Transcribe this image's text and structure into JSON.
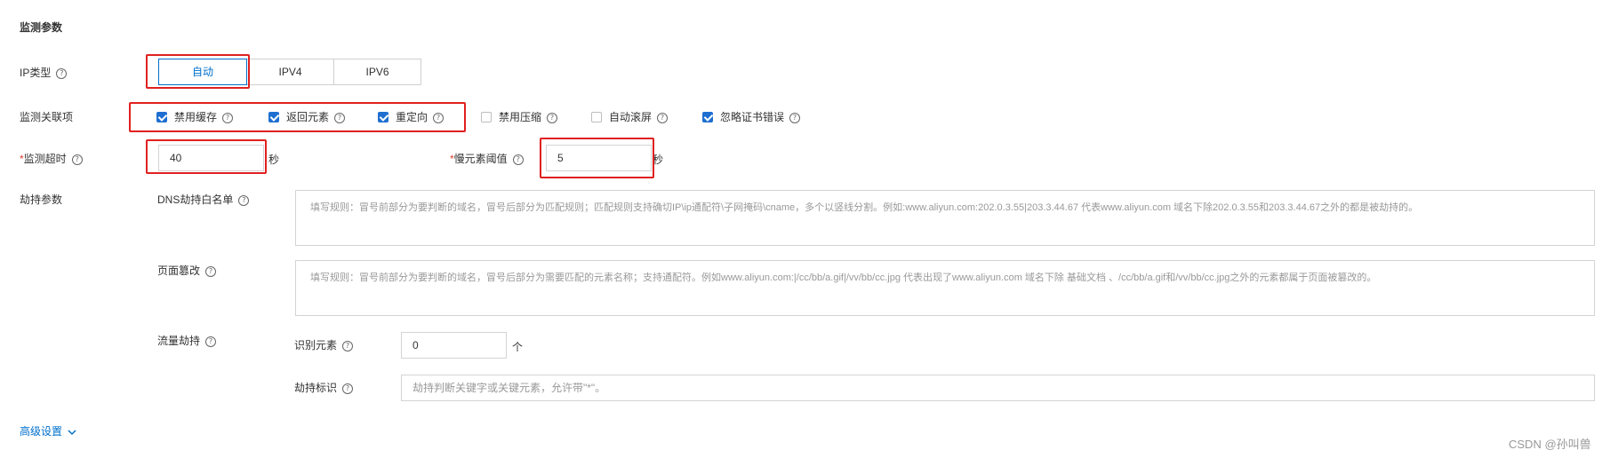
{
  "section": {
    "title": "监测参数"
  },
  "ip_type": {
    "label": "IP类型",
    "options": [
      "自动",
      "IPV4",
      "IPV6"
    ],
    "selected": "自动"
  },
  "related": {
    "label": "监测关联项",
    "items": [
      {
        "label": "禁用缓存",
        "checked": true
      },
      {
        "label": "返回元素",
        "checked": true
      },
      {
        "label": "重定向",
        "checked": true
      },
      {
        "label": "禁用压缩",
        "checked": false
      },
      {
        "label": "自动滚屏",
        "checked": false
      },
      {
        "label": "忽略证书错误",
        "checked": true
      }
    ]
  },
  "timeout": {
    "required_mark": "*",
    "label": "监测超时",
    "value": "40",
    "unit": "秒"
  },
  "slow_threshold": {
    "required_mark": "*",
    "label": "慢元素阈值",
    "value": "5",
    "unit": "秒"
  },
  "hijack": {
    "label": "劫持参数",
    "dns_whitelist": {
      "label": "DNS劫持白名单",
      "placeholder": "填写规则：冒号前部分为要判断的域名，冒号后部分为匹配规则；匹配规则支持确切IP\\ip通配符\\子网掩码\\cname，多个以竖线分割。例如:www.aliyun.com:202.0.3.55|203.3.44.67  代表www.aliyun.com 域名下除202.0.3.55和203.3.44.67之外的都是被劫持的。"
    },
    "page_tamper": {
      "label": "页面篡改",
      "placeholder": "填写规则：冒号前部分为要判断的域名，冒号后部分为需要匹配的元素名称；支持通配符。例如www.aliyun.com:|/cc/bb/a.gif|/vv/bb/cc.jpg 代表出现了www.aliyun.com 域名下除 基础文档 、/cc/bb/a.gif和/vv/bb/cc.jpg之外的元素都属于页面被篡改的。"
    },
    "traffic": {
      "label": "流量劫持",
      "identify_label": "识别元素",
      "identify_value": "0",
      "identify_unit": "个",
      "mark_label": "劫持标识",
      "mark_placeholder": "劫持判断关键字或关键元素，允许带\"*\"。"
    }
  },
  "advanced": {
    "label": "高级设置"
  },
  "watermark": "CSDN @孙叫兽",
  "colors": {
    "accent": "#0070cc",
    "highlight": "#e02020",
    "checkbox": "#1f6fd1"
  }
}
